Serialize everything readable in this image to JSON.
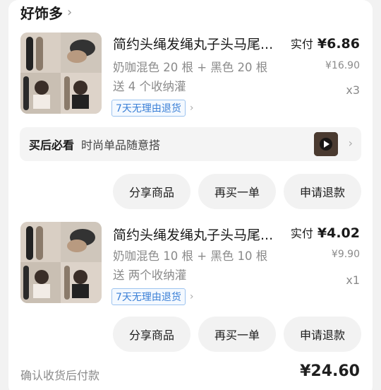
{
  "shop": {
    "name": "好饰多",
    "chevron": "›"
  },
  "items": [
    {
      "title": "简约头绳发绳丸子头马尾...",
      "spec": "奶咖混色 20 根 + 黑色 20 根　送 4 个收纳灌",
      "price_label": "实付",
      "price_real": "¥6.86",
      "price_orig": "¥16.90",
      "qty": "x3",
      "tag": "7天无理由退货",
      "tag_chevron": "›"
    },
    {
      "title": "简约头绳发绳丸子头马尾...",
      "spec": "奶咖混色 10 根 + 黑色 10 根　送 两个收纳灌",
      "price_label": "实付",
      "price_real": "¥4.02",
      "price_orig": "¥9.90",
      "qty": "x1",
      "tag": "7天无理由退货",
      "tag_chevron": "›"
    }
  ],
  "promo": {
    "bold": "买后必看",
    "text": "时尚单品随意搭",
    "icon": "play-icon"
  },
  "buttons": {
    "share": "分享商品",
    "rebuy": "再买一单",
    "refund": "申请退款"
  },
  "footer": {
    "pay_note": "确认收货后付款",
    "total": "¥24.60"
  }
}
